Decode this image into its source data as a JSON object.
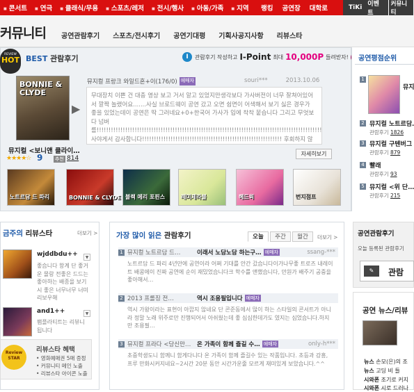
{
  "topnav": {
    "items": [
      "콘서트",
      "연극",
      "클래식/무용",
      "스포츠/레저",
      "전시/행사",
      "아동/가족",
      "지역"
    ],
    "items2": [
      "랭킹",
      "공연장",
      "대학로"
    ],
    "right": [
      "TiKi",
      "이벤트",
      "커뮤니티"
    ]
  },
  "brand": {
    "title": "커뮤니티"
  },
  "submenu": [
    "공연관람후기",
    "스포츠/전시후기",
    "공연기대평",
    "기획사공지사항",
    "리뷰스타"
  ],
  "best": {
    "badge_top": "REVIEW",
    "badge_main": "HOT",
    "title_prefix": "BEST",
    "title_rest": " 관람후기",
    "ipoint": {
      "icon": "I",
      "pre": "관람후기 작성하고",
      "brand": "I-Point",
      "max": "최대",
      "amount": "10,000P",
      "post": "들려받자!",
      "go": "GO"
    },
    "poster_text": "BONNIE & CLYDE",
    "show_title": "뮤지컬 <보니앤 클라이…",
    "stars": "★★★★☆",
    "score": "9",
    "count_label": "추천",
    "count": "814",
    "review": {
      "show": "뮤지컬 프랑크 와일드혼+이(176/0)",
      "badge": "에매자",
      "author": "souri***",
      "date": "2013.10.06",
      "body": "무대장치 이쁜 건 대충 영상 보고 거서 알고 있었지만생각보다 가사버전이 너무 잘쳐어있어서 깔짝 놀랬어요.......사실 브로드웨이 공연 갔고 오면 쉽면이 어색해서 보기 싫은 경우가 좋을 있었는데이 공연은 딱 그러네요+0+한국어 가사가 입에 착착 붙습니다 그리고 무엇보다 넘버를!!!!!!!!!!!!!!!!!!!!!!!!!!!!!!!!!!!!!!!!!!!!!!!!!!!!!!!!!!!!!!!!!!!!!!!!!!!!!!!!!!!!!!!!!!!!!!!!!!!!!!!!!!!!! 사야게서 감사합니다!!!!!!!!!!!!!!!!!!!!!!!!!!!!!!!!!!!!!!!!!!!!!!!!!!!!!!!!!!! 후회하지 않으실거에요 전 진짜 관람았어요@갔어가 보니가 빠지는 느낌이 좋 있었지만(만큼은 …",
      "more_button": "자세히보기"
    },
    "thumbs": [
      "노트르담 드 파리",
      "BONNIE & CLYDE",
      "블랙 메리 포핀스",
      "레미제라블",
      "헤드윅",
      "번지점프"
    ]
  },
  "ranking": {
    "title": "공연평점순위",
    "items": [
      {
        "n": "1",
        "name": "뮤지…",
        "sub_label": "관람후기",
        "sub_val": ""
      },
      {
        "n": "2",
        "name": "뮤지컬 노트르담…",
        "sub_label": "관람후기",
        "sub_val": "1826"
      },
      {
        "n": "3",
        "name": "뮤지컬 구텐버그",
        "sub_label": "관람후기",
        "sub_val": "879"
      },
      {
        "n": "4",
        "name": "빨래",
        "sub_label": "관람후기",
        "sub_val": "93"
      },
      {
        "n": "5",
        "name": "뮤지컬 <위 단…",
        "sub_label": "관람후기",
        "sub_val": "215"
      }
    ]
  },
  "reviewstar": {
    "title_prefix": "금주의",
    "title_rest": " 리뷰스타",
    "more": "더보기 >",
    "users": [
      {
        "name": "wjddbdu++",
        "text": "좋습니다 항계 단 좋거 운 몰랑 전좋은 드드는 좋아하는 배종을 보기 시 좋은 너무너무 너미리보우해"
      },
      {
        "name": "and1++",
        "text": "팸플라티트는 리뷰니 됩니다"
      }
    ],
    "benefit": {
      "star_text": "Review STAR",
      "title": "리뷰스타 혜택",
      "items": [
        "• 영화예매권 5매 증정",
        "• 커뮤니티 메인 노출",
        "• 리뷰스타 아이콘 노출"
      ]
    }
  },
  "most_read": {
    "title_prefix": "가장 많이 읽은",
    "title_rest": " 관람후기",
    "tabs": [
      "오늘",
      "주간",
      "월간"
    ],
    "more": "더보기 >",
    "rows": [
      {
        "n": "1",
        "show": "뮤지컬 노트르담 드…",
        "title": "이래서 노담노담 하는구…",
        "badge": "에매자",
        "author": "ssang-***",
        "body": "노트르담 드 파리 4년만에 공연이라 어쩌 기대를 안간 갔습니다이가나무좋 트로즈 내레이트 배콩에이 진짜 공연에 순이 재밌었습니다크 학수를 앤했습니다, 만원가 배주기 공중을 좋아해서…"
      },
      {
        "n": "2",
        "show": "2013 프롤징 전…",
        "title": "역시 조용필입니다",
        "badge": "에매자",
        "author": "",
        "body": "역시 가왕이라는 표현이 아깝지 않네요 단 콘준동에서 많이 하는 스타일의 콘서트가 아니라 정말 노래 위주로만 진행되어서 아쉬웠는데 좋 심심한데가도 였지는 심었습니다.하지만 조용필…"
      },
      {
        "n": "3",
        "show": "뮤지컬 프라다 <당신만…",
        "title": "온 가족이 함께 즐길 수…",
        "badge": "에매자",
        "author": "only-h***",
        "body": "초중학생도니 함께니 함게다니다 온 가족이 함께 즐길수 있는 작품입니다. 초등과 강흥, 프루 만화시커지네요~2시간 20분 동안 시간가운줄 모르게 재미있게 보았습니다.^^"
      }
    ]
  },
  "performance_review": {
    "title": "공연관람후기",
    "desc": "오늘 등록된 관람후기",
    "button": "관람",
    "button_icon": "✎"
  },
  "news": {
    "title": "공연 뉴스/리뷰",
    "items": [
      {
        "label": "뉴스",
        "text": "손모(은)의 조"
      },
      {
        "label": "뉴스",
        "text": "고딩 비 들"
      },
      {
        "label": "시와폰",
        "text": "조기로 커지"
      },
      {
        "label": "시와폰",
        "text": "시로 드러나"
      }
    ]
  }
}
